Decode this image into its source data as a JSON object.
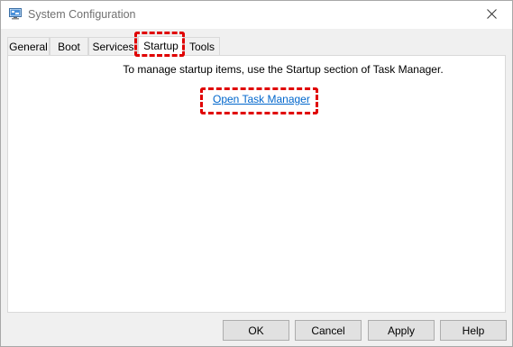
{
  "window": {
    "title": "System Configuration",
    "app_icon": "msconfig-icon",
    "close_icon": "close-icon"
  },
  "tabs": [
    {
      "label": "General",
      "active": false
    },
    {
      "label": "Boot",
      "active": false
    },
    {
      "label": "Services",
      "active": false
    },
    {
      "label": "Startup",
      "active": true
    },
    {
      "label": "Tools",
      "active": false
    }
  ],
  "startup": {
    "message": "To manage startup items, use the Startup section of Task Manager.",
    "link_label": "Open Task Manager"
  },
  "buttons": {
    "ok": "OK",
    "cancel": "Cancel",
    "apply": "Apply",
    "help": "Help"
  },
  "colors": {
    "highlight": "#e00000",
    "link": "#0066cc"
  }
}
